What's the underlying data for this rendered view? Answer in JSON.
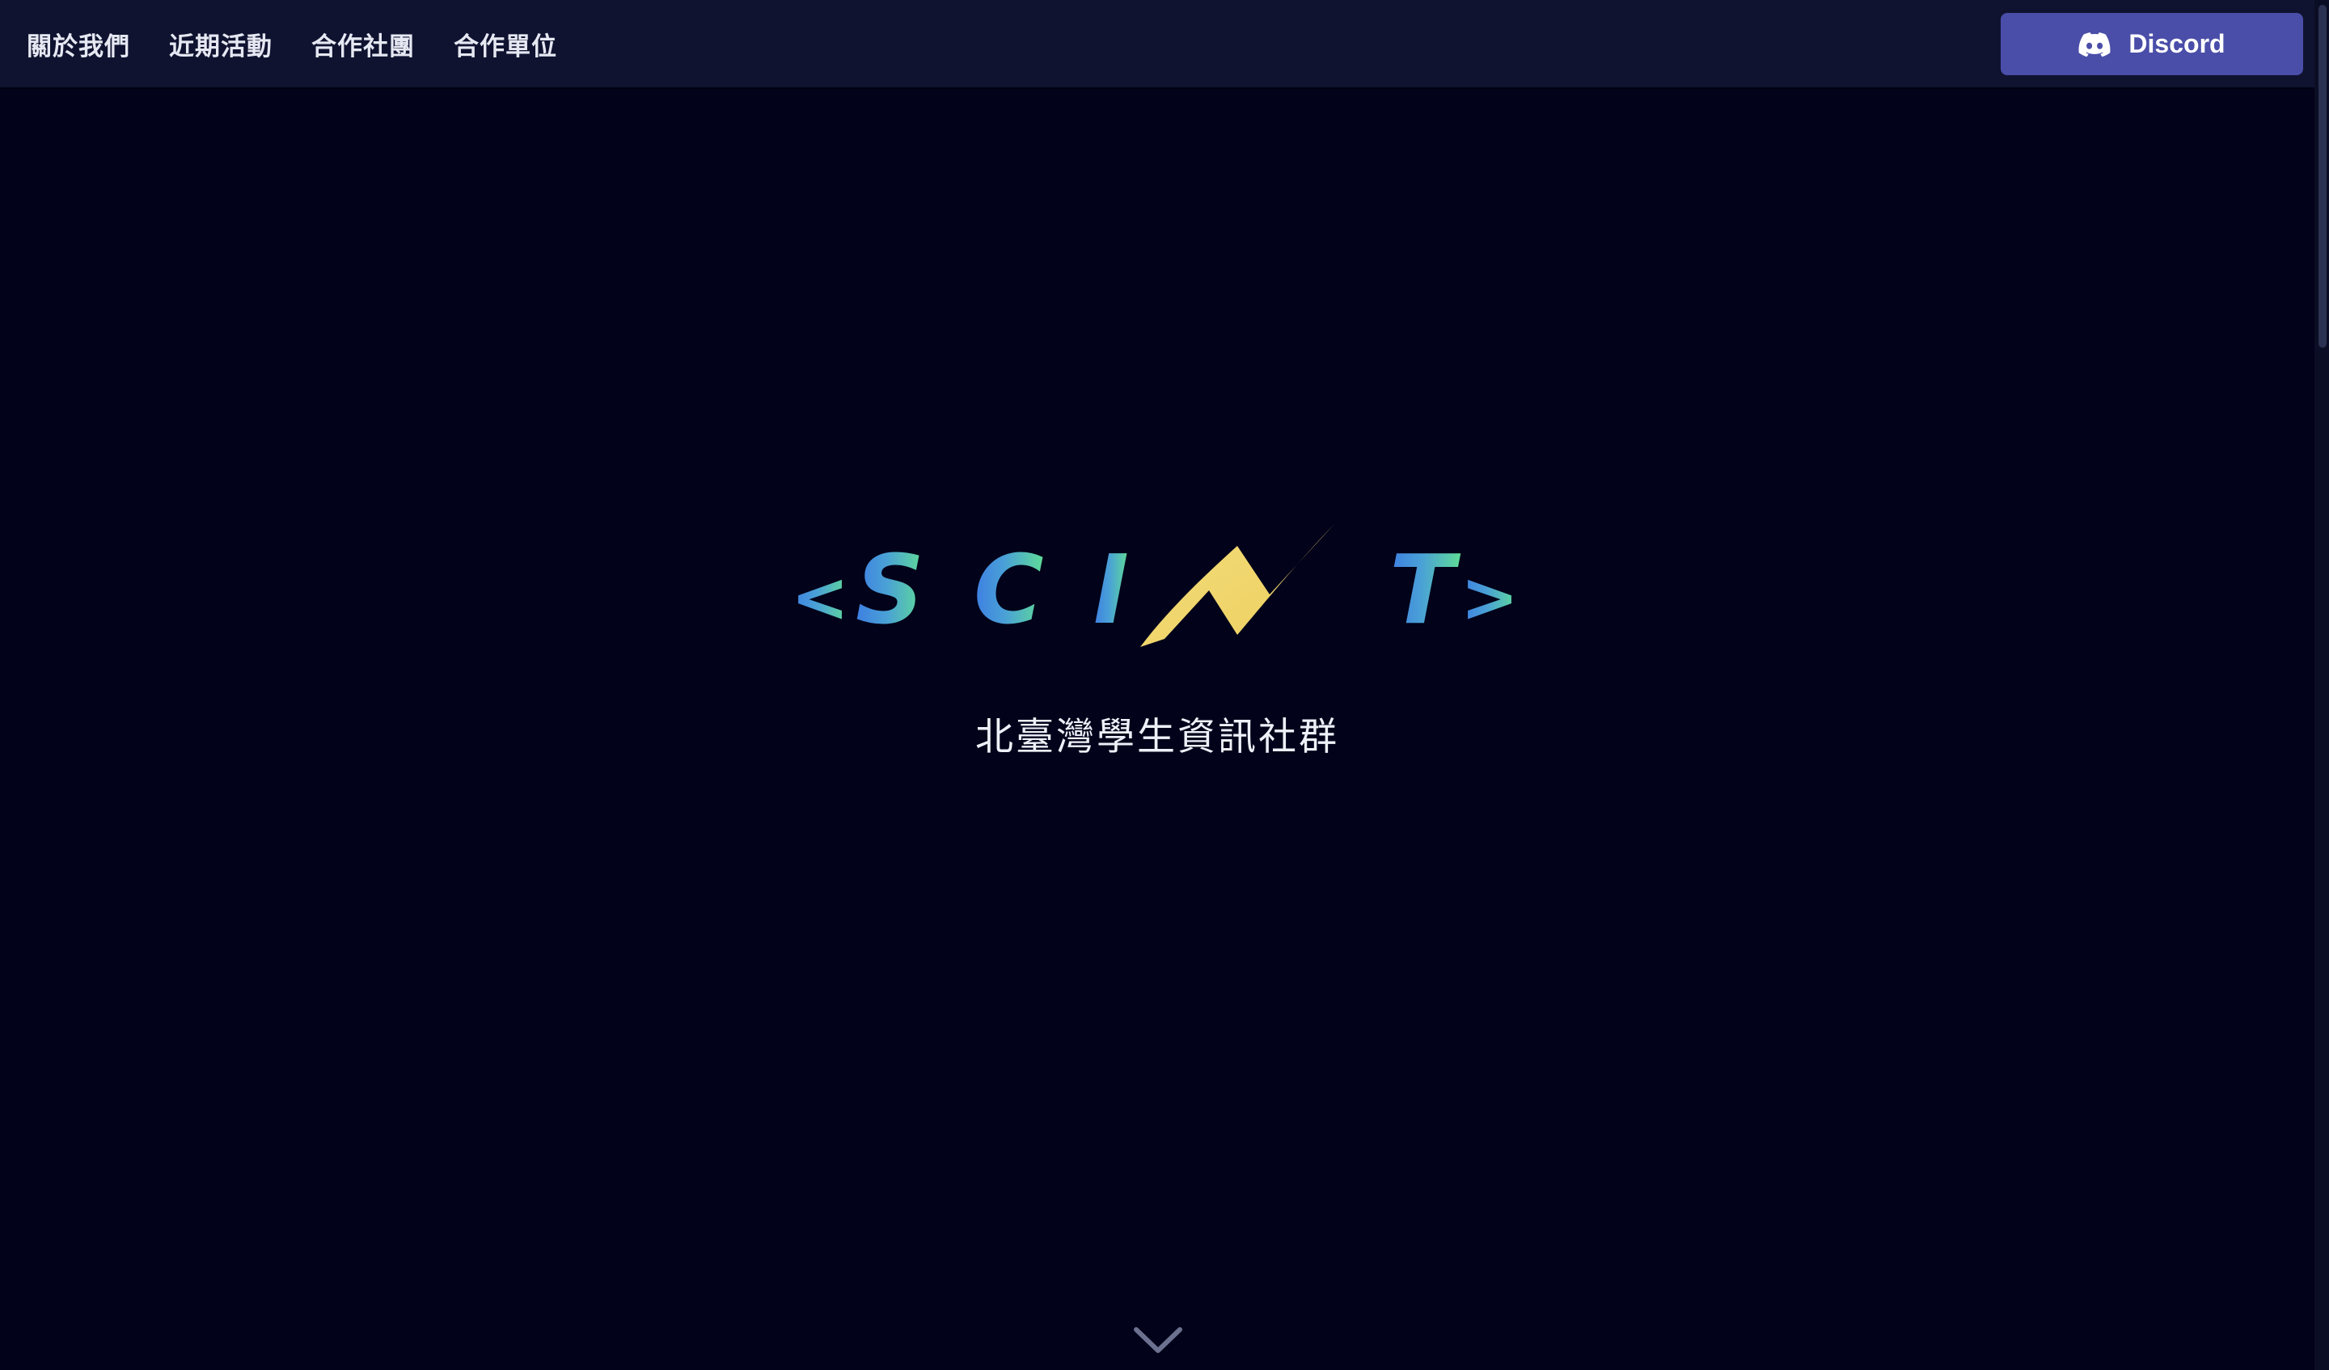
{
  "nav": {
    "items": [
      {
        "label": "關於我們"
      },
      {
        "label": "近期活動"
      },
      {
        "label": "合作社團"
      },
      {
        "label": "合作單位"
      }
    ],
    "discord": {
      "label": "Discord",
      "icon": "discord-icon"
    }
  },
  "hero": {
    "logo": {
      "text": "<S C I T>",
      "icon": "lightning-bolt-icon",
      "gradient_start": "#3d7ee3",
      "gradient_end": "#5fdc96",
      "bolt_color": "#f2d56f"
    },
    "subtitle": "北臺灣學生資訊社群",
    "scroll_icon": "chevron-down-icon"
  },
  "colors": {
    "background": "#02021a",
    "navbar": "#0f1330",
    "discord_button": "#4a4ea8"
  }
}
